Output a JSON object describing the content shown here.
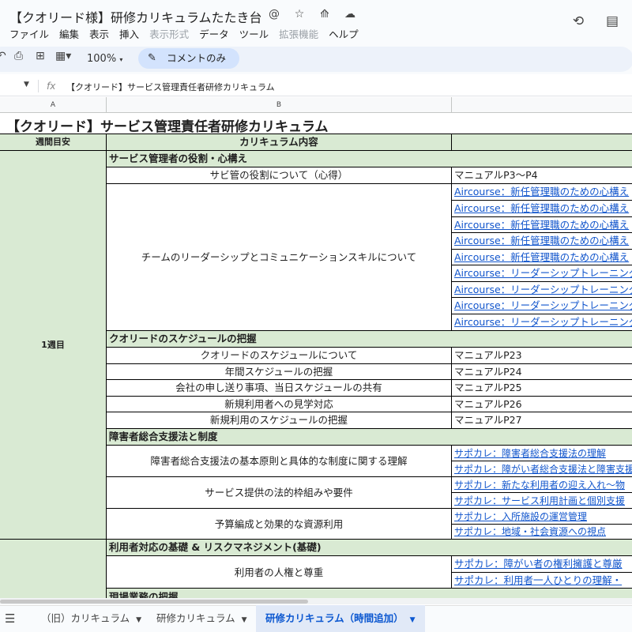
{
  "doc": {
    "title": "【クオリード様】研修カリキュラムたたき台",
    "title_icons": [
      "@",
      "☆",
      "⟰",
      "☁"
    ]
  },
  "menu": {
    "items": [
      {
        "label": "ファイル",
        "enabled": true
      },
      {
        "label": "編集",
        "enabled": true
      },
      {
        "label": "表示",
        "enabled": true
      },
      {
        "label": "挿入",
        "enabled": true
      },
      {
        "label": "表示形式",
        "enabled": false
      },
      {
        "label": "データ",
        "enabled": true
      },
      {
        "label": "ツール",
        "enabled": true
      },
      {
        "label": "拡張機能",
        "enabled": false
      },
      {
        "label": "ヘルプ",
        "enabled": true
      }
    ]
  },
  "toolbar": {
    "zoom": "100%",
    "comment_mode": "コメントのみ"
  },
  "formula_bar": {
    "fx_label": "fx",
    "content": "【クオリード】サービス管理責任者研修カリキュラム"
  },
  "columns": [
    "A",
    "B"
  ],
  "sheet": {
    "title": "【クオリード】サービス管理責任者研修カリキュラム",
    "headers": {
      "a": "週間目安",
      "b": "カリキュラム内容"
    },
    "week1": "1週目",
    "sec1": "サービス管理者の役割・心構え",
    "r1_b": "サビ管の役割について（心得）",
    "r1_c": "マニュアルP3〜P4",
    "r2_b": "チームのリーダーシップとコミュニケーションスキルについて",
    "r2_links": [
      "Aircourse：新任管理職のための心構え",
      "Aircourse：新任管理職のための心構え",
      "Aircourse：新任管理職のための心構え",
      "Aircourse：新任管理職のための心構え",
      "Aircourse：新任管理職のための心構え",
      "Aircourse：リーダーシップトレーニング",
      "Aircourse：リーダーシップトレーニング",
      "Aircourse：リーダーシップトレーニング",
      "Aircourse：リーダーシップトレーニング"
    ],
    "sec2": "クオリードのスケジュールの把握",
    "sched": [
      {
        "b": "クオリードのスケジュールについて",
        "c": "マニュアルP23"
      },
      {
        "b": "年間スケジュールの把握",
        "c": "マニュアルP24"
      },
      {
        "b": "会社の申し送り事項、当日スケジュールの共有",
        "c": "マニュアルP25"
      },
      {
        "b": "新規利用者への見学対応",
        "c": "マニュアルP26"
      },
      {
        "b": "新規利用のスケジュールの把握",
        "c": "マニュアルP27"
      }
    ],
    "sec3": "障害者総合支援法と制度",
    "law1_b": "障害者総合支援法の基本原則と具体的な制度に関する理解",
    "law1_links": [
      "サポカレ：障害者総合支援法の理解",
      "サポカレ：障がい者総合支援法と障害支援"
    ],
    "law2_b": "サービス提供の法的枠組みや要件",
    "law2_links": [
      "サポカレ：新たな利用者の迎え入れ〜物",
      "サポカレ：サービス利用計画と個別支援"
    ],
    "law3_b": "予算編成と効果的な資源利用",
    "law3_links": [
      "サポカレ：入所施設の運営管理",
      "サポカレ：地域・社会資源への視点"
    ],
    "sec4": "利用者対応の基礎 & リスクマネジメント(基礎)",
    "rights_b": "利用者の人権と尊重",
    "rights_links": [
      "サポカレ：障がい者の権利擁護と尊厳",
      "サポカレ：利用者一人ひとりの理解・"
    ],
    "sec5": "現場業務の把握"
  },
  "tabs": [
    {
      "label": "（旧）カリキュラム",
      "active": false
    },
    {
      "label": "研修カリキュラム",
      "active": false
    },
    {
      "label": "研修カリキュラム（時間追加）",
      "active": true
    }
  ],
  "colors": {
    "header_green": "#d9ead3",
    "link_blue": "#1155cc",
    "active_tab": "#0b57d0"
  }
}
